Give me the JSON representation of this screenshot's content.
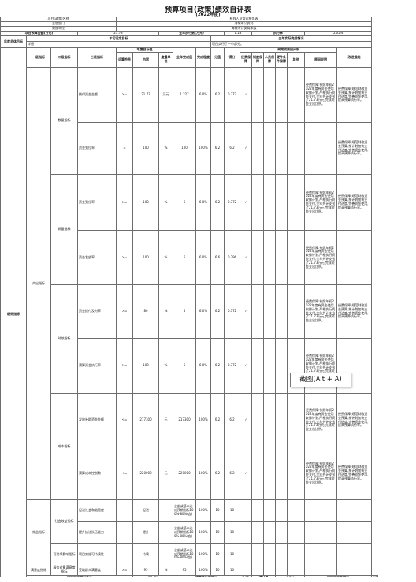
{
  "header": {
    "title": "预算项目(政策)绩效自评表",
    "subtitle": "(2022年度)"
  },
  "info": {
    "project_name_label": "项目(政策)名称",
    "project_name": "有线人员管家服务表",
    "dept_label": "主管部门",
    "dept": "海城市公安局",
    "unit_label": "实施单位",
    "unit": "海城市公安局本级",
    "budget_label": "项目预算金额(万元)",
    "budget": "21.73",
    "exec_label": "全年执行数(万元)",
    "exec": "1.23",
    "rate_label": "执行率",
    "rate": "5.65%"
  },
  "goal": {
    "label": "年度总体目标",
    "planned_label": "年初设定目标",
    "actual_label": "全年实际完成情况",
    "planned": "详细",
    "actual": "项目实行了一小部分。"
  },
  "columns": {
    "perf": "绩效指标",
    "lvl1": "一级指标",
    "lvl2": "二级指标",
    "lvl3": "三级指标",
    "annual": "年度目标值",
    "op": "运算符号",
    "content": "内容",
    "unit": "度量单位",
    "actual": "全年完成值",
    "rate": "完成程度",
    "weight": "分值",
    "score": "得分",
    "deviation": "未完成原因分析",
    "dev_econ": "经费保障",
    "dev_sys": "制度保障",
    "dev_staff": "人员保障",
    "dev_hw": "硬件条件保障",
    "dev_other": "其他",
    "reason": "原因说明",
    "improve": "改进措施"
  },
  "reason_text": "经费保障:依照年初2022年度有资金使用安排计划,严格执行资金支付,全年共计支出了21.73万元,完成资金支出比例。",
  "improve_text": "经费保障:规范财政资金预算,按计划加快支付进度,完善资金使用,提高预算执行率。",
  "categories": {
    "output": "产出指标",
    "quantity": "数量指标",
    "quality": "质量指标",
    "timeliness": "时效指标",
    "cost": "成本指标",
    "effect": "效益指标",
    "social": "社会效益指标",
    "sustain": "可持续影响指标",
    "satisfaction": "满意度指标",
    "satisfaction2": "服务对象满意度指标"
  },
  "rows": [
    {
      "name": "拨付资金金额",
      "op": ">=",
      "content": "21.73",
      "unit": "万元",
      "actual": "1.227",
      "rate": "6.0%",
      "weight": "6.2",
      "score": "0.372",
      "check": "✓"
    },
    {
      "name": "资金到位率",
      "op": "=",
      "content": "100",
      "unit": "%",
      "actual": "100",
      "rate": "100%",
      "weight": "6.2",
      "score": "6.2",
      "check": "✓"
    },
    {
      "name": "资金到位率",
      "op": ">=",
      "content": "100",
      "unit": "%",
      "actual": "6",
      "rate": "6.0%",
      "weight": "6.2",
      "score": "0.372",
      "check": "✓"
    },
    {
      "name": "资金发放率",
      "op": ">=",
      "content": "100",
      "unit": "%",
      "actual": "6",
      "rate": "6.0%",
      "weight": "6.6",
      "score": "0.396",
      "check": "✓"
    },
    {
      "name": "资金拨付及时率",
      "op": ">=",
      "content": "80",
      "unit": "%",
      "actual": "5",
      "rate": "6.0%",
      "weight": "6.2",
      "score": "0.372",
      "check": "✓"
    },
    {
      "name": "预算资金执行率",
      "op": ">=",
      "content": "100",
      "unit": "%",
      "actual": "6",
      "rate": "6.0%",
      "weight": "6.2",
      "score": "0.372",
      "check": "✓"
    },
    {
      "name": "发放补助资金金额",
      "op": "<=",
      "content": "217300",
      "unit": "元",
      "actual": "217300",
      "rate": "100%",
      "weight": "6.2",
      "score": "6.2",
      "check": "✓"
    },
    {
      "name": "预算成本控制数",
      "op": "<=",
      "content": "220000",
      "unit": "元",
      "actual": "220000",
      "rate": "100%",
      "weight": "6.2",
      "score": "6.2",
      "check": "✓"
    }
  ],
  "effect_rows": [
    {
      "name": "促进社会和谐稳定",
      "content": "促进",
      "actual": "全部或基本达成预期指标100%-80%(含)",
      "rate": "100%",
      "weight": "10",
      "score": "10"
    },
    {
      "name": "提升执法队伍能力",
      "content": "提升",
      "actual": "全部或基本达成预期指标100%-80%(含)",
      "rate": "100%",
      "weight": "10",
      "score": "10"
    },
    {
      "name": "项目实施可持续性",
      "content": "持续",
      "actual": "全部或基本达成预期指标100%-80%(含)",
      "rate": "100%",
      "weight": "10",
      "score": "10"
    }
  ],
  "sat_row": {
    "name": "受助群众满意度",
    "op": ">=",
    "content": "95",
    "unit": "%",
    "actual": "95",
    "rate": "100%",
    "weight": "10",
    "score": "10"
  },
  "footer": {
    "total_label": "项目自评得分合计",
    "total": "60.48",
    "exec_score_label": "预算执行率得分",
    "exec_score": "0.56",
    "total_weight_label": "满分值",
    "weight_val": "2.0分",
    "self_score_label": "项目自评总得分",
    "self_score": "59"
  },
  "tooltip": "截图(Alt + A)"
}
